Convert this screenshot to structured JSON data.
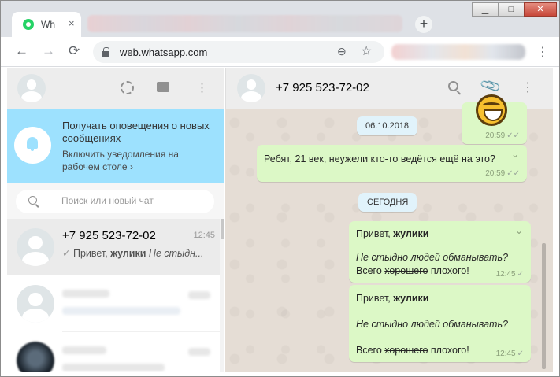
{
  "browser": {
    "tab_title": "Wh",
    "tab_close": "×",
    "new_tab": "+",
    "url": "web.whatsapp.com",
    "back": "←",
    "forward": "→",
    "reload": "⟳",
    "menu": "⋮",
    "window_buttons": {
      "minimize": "▁",
      "maximize": "□",
      "close": "✕"
    },
    "icons": {
      "favicon": "whatsapp-favicon-icon",
      "lock": "lock-icon",
      "zoom": "zoom-icon",
      "bookmark": "star-icon"
    }
  },
  "sidebar": {
    "header_icons": {
      "status": "status-icon",
      "new_chat": "chat-icon",
      "menu": "⋮"
    },
    "notification": {
      "title": "Получать оповещения о новых сообщениях",
      "subtitle": "Включить уведомления на рабочем столе",
      "subtitle_chevron": "›",
      "icon": "bell-off-icon"
    },
    "search": {
      "placeholder": "Поиск или новый чат"
    },
    "chats": [
      {
        "name": "+7 925 523-72-02",
        "time": "12:45",
        "preview_check": "✓",
        "preview_plain": "Привет, ",
        "preview_bold": "жулики",
        "preview_italic": " Не стыдн..."
      }
    ]
  },
  "conversation": {
    "contact_name": "+7 925 523-72-02",
    "header_icons": {
      "search": "search-icon",
      "attach": "📎",
      "menu": "⋮"
    },
    "messages": [
      {
        "kind": "emoji",
        "time": "20:59",
        "status": "✓✓"
      },
      {
        "kind": "date",
        "label": "06.10.2018"
      },
      {
        "kind": "text",
        "text": "Ребят, 21 век, неужели кто-то ведётся ещё на это?",
        "time": "20:59",
        "status": "✓✓",
        "chevron": "⌄"
      },
      {
        "kind": "date",
        "label": "СЕГОДНЯ"
      },
      {
        "kind": "text",
        "greeting_plain": "Привет, ",
        "greeting_bold": "жулики",
        "line2": "Не стыдно людей обманывать?",
        "line3_a": "Всего ",
        "line3_strike": "хорошего",
        "line3_b": " плохого!",
        "time": "12:45",
        "status": "✓",
        "chevron": "⌄"
      },
      {
        "kind": "text",
        "greeting_plain": "Привет, ",
        "greeting_bold": "жулики",
        "line2": "Не стыдно людей обманывать?",
        "line3_a": "Всего ",
        "line3_strike": "хорошего",
        "line3_b": " плохого!",
        "time": "12:45",
        "status": "✓"
      }
    ]
  },
  "colors": {
    "notification_bg": "#9de1fe",
    "outgoing_bubble": "#dcf8c6",
    "date_pill": "#e1f3fb",
    "chat_bg": "#e5ddd5",
    "header_bg": "#ededed",
    "whatsapp_green": "#25d366"
  }
}
